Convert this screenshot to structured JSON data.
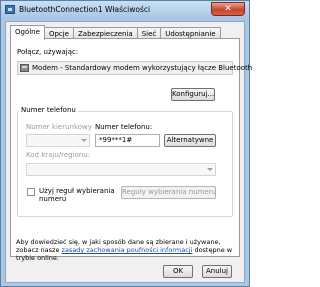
{
  "window": {
    "title": "BluetoothConnection1 Właściwości",
    "close_glyph": "✕"
  },
  "tabs": [
    {
      "label": "Ogólne",
      "active": true
    },
    {
      "label": "Opcje",
      "active": false
    },
    {
      "label": "Zabezpieczenia",
      "active": false
    },
    {
      "label": "Sieć",
      "active": false
    },
    {
      "label": "Udostępnianie",
      "active": false
    }
  ],
  "general": {
    "connect_using_label": "Połącz, używając:",
    "modem_name": "Modem - Standardowy modem wykorzystujący łącze Bluetooth",
    "configure_button": "Konfiguruj...",
    "phone_group_title": "Numer telefonu",
    "area_code_label": "Numer kierunkowy",
    "area_code_value": "",
    "phone_number_label": "Numer telefonu:",
    "phone_number_value": "*99***1#",
    "alternates_button": "Alternatywne",
    "country_label": "Kod kraju/regionu:",
    "country_value": "",
    "use_dialing_rules_line1": "Użyj reguł wybierania",
    "use_dialing_rules_line2": "numeru",
    "dialing_rules_button": "Reguły wybierania numeru",
    "info_line1": "Aby dowiedzieć się, w jaki sposób dane są zbierane i używane,",
    "info_prefix": "zobacz nasze ",
    "privacy_link": "zasady zachowania poufności informacji",
    "info_suffix": " dostępne w",
    "info_line3": "trybie online."
  },
  "footer": {
    "ok_button": "OK",
    "cancel_button": "Anuluj"
  },
  "colors": {
    "frame": "#a9c8e4",
    "link": "#1a4fa0",
    "close_button": "#c7452c"
  },
  "icons": {
    "window_icon": "network-connection-icon",
    "modem_icon": "modem-icon"
  }
}
